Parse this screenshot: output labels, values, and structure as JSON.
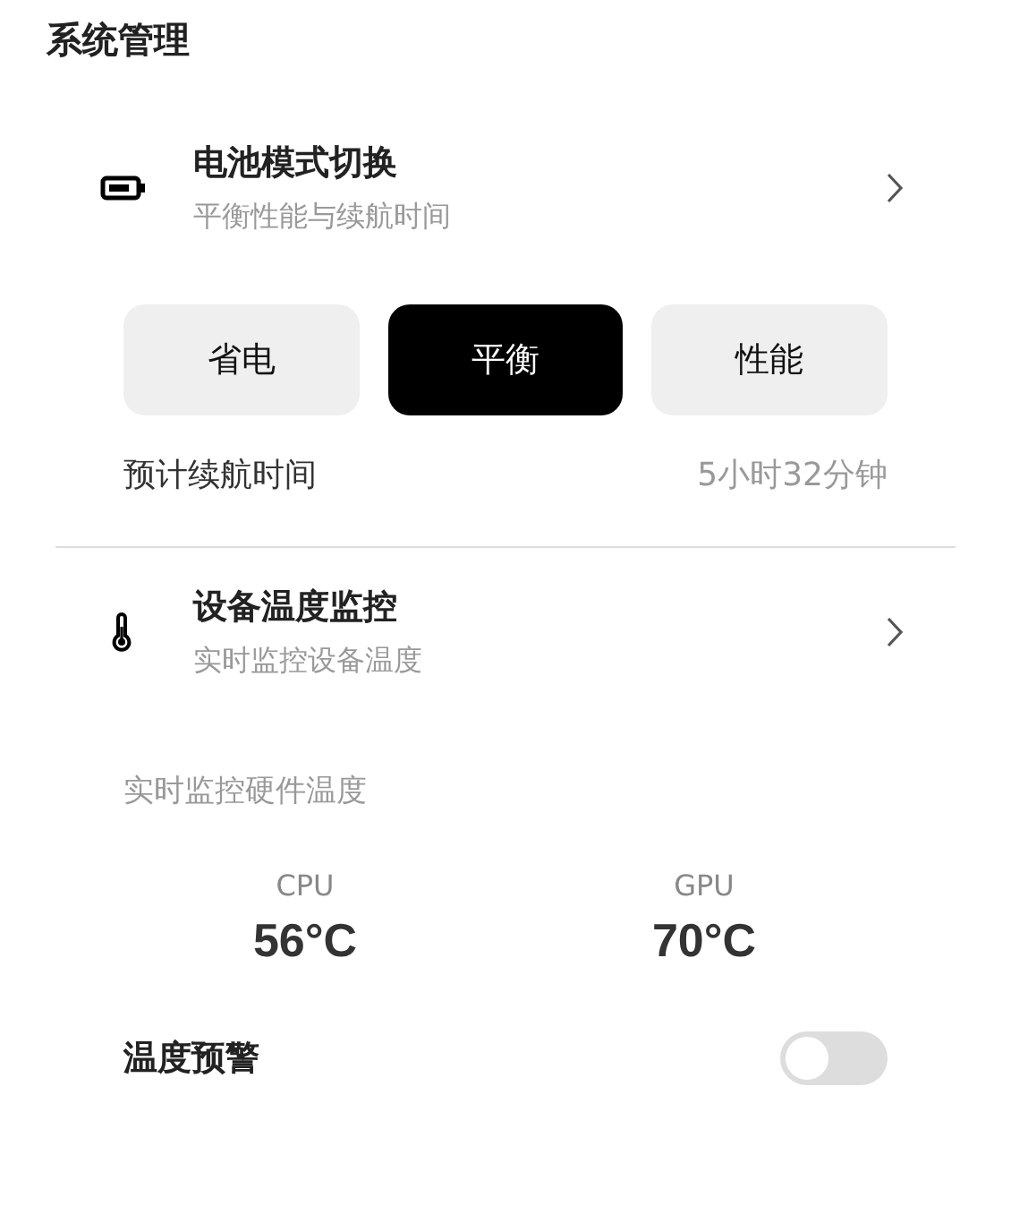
{
  "title": "系统管理",
  "battery": {
    "title": "电池模式切换",
    "subtitle": "平衡性能与续航时间",
    "modes": [
      {
        "label": "省电",
        "selected": false
      },
      {
        "label": "平衡",
        "selected": true
      },
      {
        "label": "性能",
        "selected": false
      }
    ],
    "estimate_label": "预计续航时间",
    "estimate_value": "5小时32分钟"
  },
  "temperature": {
    "title": "设备温度监控",
    "subtitle": "实时监控设备温度",
    "caption": "实时监控硬件温度",
    "readings": [
      {
        "name": "CPU",
        "value": "56°C"
      },
      {
        "name": "GPU",
        "value": "70°C"
      }
    ],
    "alert": {
      "label": "温度预警",
      "on": false
    }
  }
}
